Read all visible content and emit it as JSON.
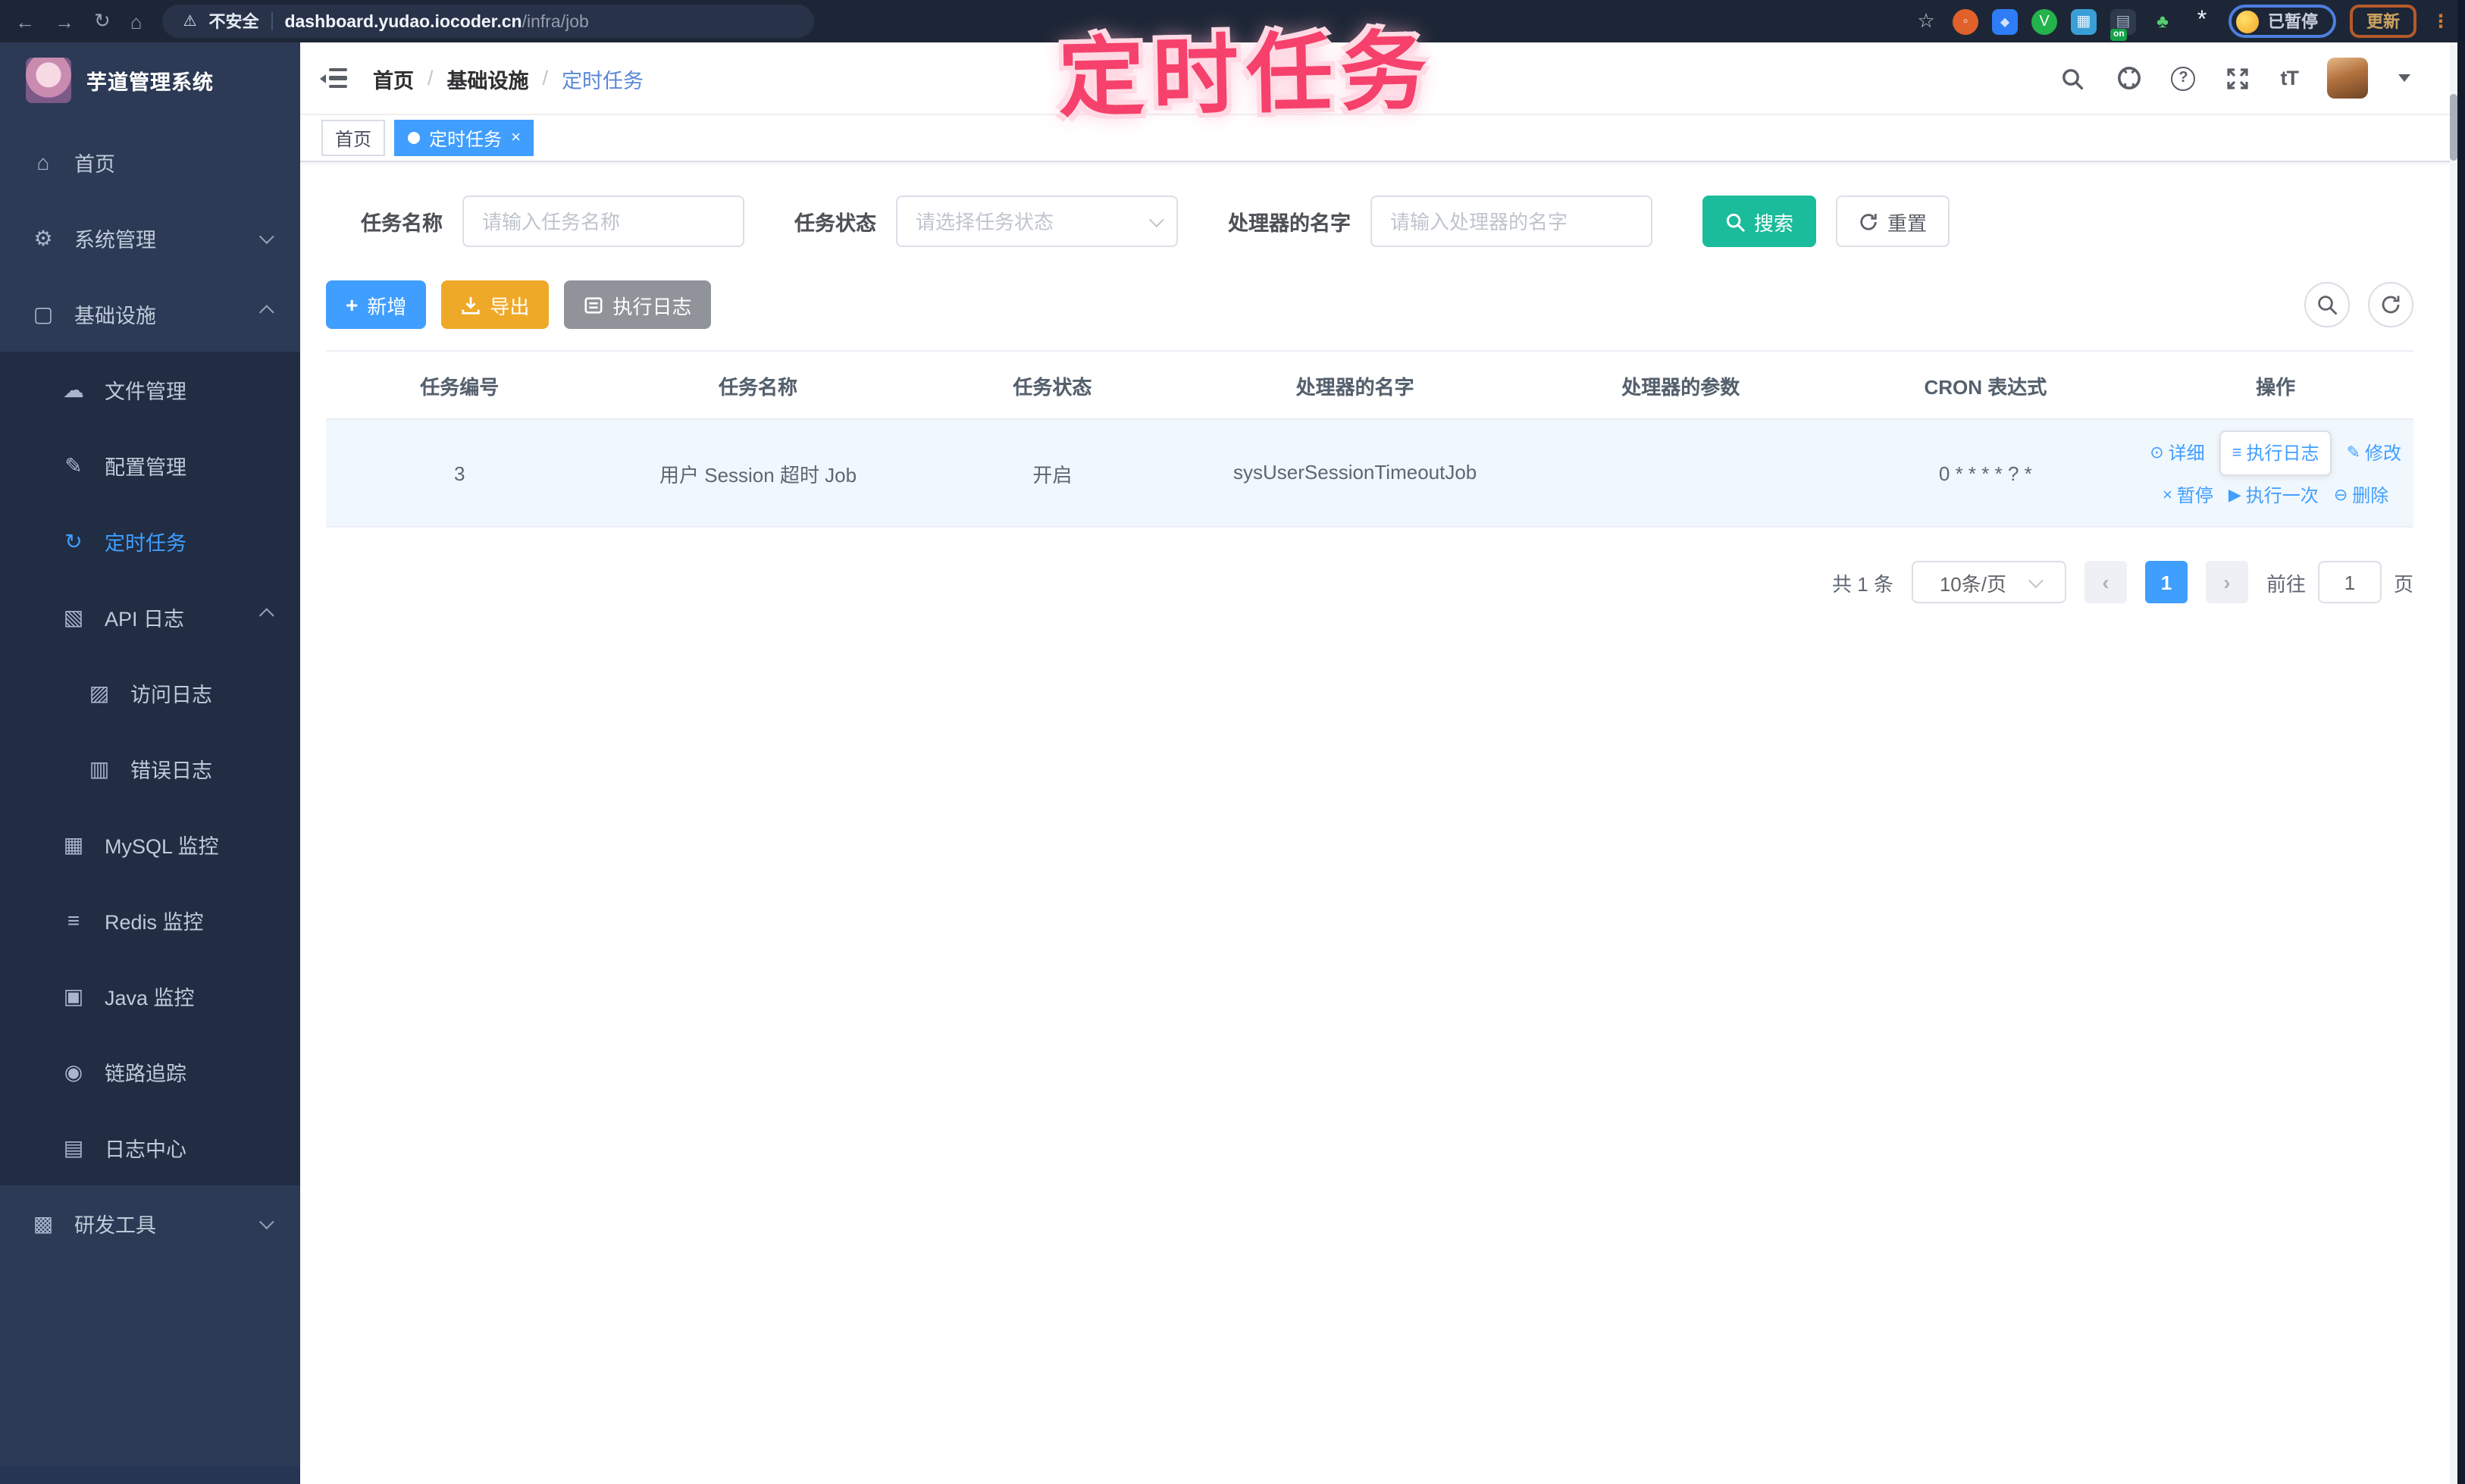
{
  "colors": {
    "accent": "#409EFF",
    "search_teal": "#1BBC9B",
    "warning_orange": "#EFA928",
    "info_gray": "#909399",
    "annotation_pink": "#F5416B",
    "sidebar_bg": "#2C3A55",
    "submenu_bg": "#212D42",
    "tag_active_bg": "#409EFF"
  },
  "glyphs": {
    "back": "←",
    "forward": "→",
    "reload": "↻",
    "home": "⌂",
    "warning": "⚠",
    "dots": "⋮",
    "help": "?",
    "fontsize": "tT",
    "plus": "+",
    "close": "×",
    "separator": "/"
  },
  "browser": {
    "security_label": "不安全",
    "url_domain": "dashboard.yudao.iocoder.cn",
    "url_path": "/infra/job",
    "paused_label": "已暂停",
    "update_label": "更新",
    "extensions": [
      {
        "key": "bookmark-star",
        "glyph": "☆",
        "fg": "#C8CFDD",
        "bg": "",
        "round": true,
        "size": 13
      },
      {
        "key": "ext-orange",
        "glyph": "◦",
        "fg": "#FFE3D1",
        "bg": "#E0612A",
        "round": true,
        "size": 10
      },
      {
        "key": "ext-blue-gem",
        "glyph": "◆",
        "fg": "#CFE2FF",
        "bg": "#2E7CF6",
        "round": false,
        "size": 8
      },
      {
        "key": "ext-green-check",
        "glyph": "V",
        "fg": "#FFFFFF",
        "bg": "#23B24B",
        "round": true,
        "size": 10
      },
      {
        "key": "ext-cube-blue",
        "glyph": "▦",
        "fg": "#E8F6FF",
        "bg": "#399FD6",
        "round": false,
        "size": 10
      },
      {
        "key": "ext-dark-list",
        "glyph": "▤",
        "fg": "#9FB0C5",
        "bg": "#2F3A4A",
        "round": false,
        "size": 10,
        "badge": "on"
      },
      {
        "key": "ext-leaf",
        "glyph": "♣",
        "fg": "#54D06E",
        "bg": "",
        "round": false,
        "size": 12
      },
      {
        "key": "ext-pinwheel",
        "glyph": "*",
        "fg": "#EEF1F7",
        "bg": "",
        "round": true,
        "size": 16
      }
    ]
  },
  "annotation": {
    "text": "定时任务"
  },
  "sidebar": {
    "logo_title": "芋道管理系统",
    "items": [
      {
        "key": "home",
        "label": "首页",
        "icon": "home-icon",
        "glyph": "⌂",
        "level": 0
      },
      {
        "key": "system",
        "label": "系统管理",
        "icon": "gear-icon",
        "glyph": "⚙",
        "level": 0,
        "chevron": "down"
      },
      {
        "key": "infra",
        "label": "基础设施",
        "icon": "monitor-icon",
        "glyph": "▢",
        "level": 0,
        "chevron": "up"
      },
      {
        "key": "file",
        "label": "文件管理",
        "icon": "cloud-upload-icon",
        "glyph": "☁",
        "level": 1
      },
      {
        "key": "config",
        "label": "配置管理",
        "icon": "edit-square-icon",
        "glyph": "✎",
        "level": 1
      },
      {
        "key": "job",
        "label": "定时任务",
        "icon": "schedule-icon",
        "glyph": "↻",
        "level": 1,
        "active": true
      },
      {
        "key": "api-log",
        "label": "API 日志",
        "icon": "api-log-icon",
        "glyph": "▧",
        "level": 1,
        "chevron": "up"
      },
      {
        "key": "access-log",
        "label": "访问日志",
        "icon": "access-log-icon",
        "glyph": "▨",
        "level": 2
      },
      {
        "key": "error-log",
        "label": "错误日志",
        "icon": "error-log-icon",
        "glyph": "▥",
        "level": 2
      },
      {
        "key": "mysql",
        "label": "MySQL 监控",
        "icon": "mysql-monitor-icon",
        "glyph": "▦",
        "level": 1
      },
      {
        "key": "redis",
        "label": "Redis 监控",
        "icon": "redis-monitor-icon",
        "glyph": "≡",
        "level": 1
      },
      {
        "key": "java",
        "label": "Java 监控",
        "icon": "java-monitor-icon",
        "glyph": "▣",
        "level": 1
      },
      {
        "key": "trace",
        "label": "链路追踪",
        "icon": "trace-eye-icon",
        "glyph": "◉",
        "level": 1
      },
      {
        "key": "log-center",
        "label": "日志中心",
        "icon": "log-center-icon",
        "glyph": "▤",
        "level": 1
      },
      {
        "key": "devtool",
        "label": "研发工具",
        "icon": "toolbox-icon",
        "glyph": "▩",
        "level": 0,
        "chevron": "down"
      }
    ]
  },
  "header": {
    "breadcrumb": [
      "首页",
      "基础设施",
      "定时任务"
    ]
  },
  "tags": {
    "home": "首页",
    "active": "定时任务"
  },
  "filter": {
    "name_label": "任务名称",
    "name_placeholder": "请输入任务名称",
    "status_label": "任务状态",
    "status_placeholder": "请选择任务状态",
    "handler_label": "处理器的名字",
    "handler_placeholder": "请输入处理器的名字",
    "search_label": "搜索",
    "reset_label": "重置"
  },
  "toolbar": {
    "add_label": "新增",
    "export_label": "导出",
    "log_label": "执行日志"
  },
  "table": {
    "columns": [
      "任务编号",
      "任务名称",
      "任务状态",
      "处理器的名字",
      "处理器的参数",
      "CRON 表达式",
      "操作"
    ],
    "row": {
      "id": "3",
      "name": "用户 Session 超时 Job",
      "status": "开启",
      "handler": "sysUserSessionTimeoutJob",
      "param": "",
      "cron": "0 * * * * ? *"
    },
    "actions_row1": [
      {
        "key": "detail",
        "label": "详细",
        "glyph": "⊙"
      },
      {
        "key": "job-log",
        "label": "执行日志",
        "glyph": "≡",
        "boxed": true
      },
      {
        "key": "modify",
        "label": "修改",
        "glyph": "✎"
      }
    ],
    "actions_row2": [
      {
        "key": "pause",
        "label": "暂停",
        "glyph": "×"
      },
      {
        "key": "run-once",
        "label": "执行一次",
        "glyph": "▶"
      },
      {
        "key": "delete",
        "label": "删除",
        "glyph": "⊖"
      }
    ]
  },
  "pagination": {
    "total": "共 1 条",
    "page_size": "10条/页",
    "page": "1",
    "prev": "‹",
    "next": "›",
    "goto_label": "前往",
    "goto_value": "1",
    "unit_label": "页"
  }
}
